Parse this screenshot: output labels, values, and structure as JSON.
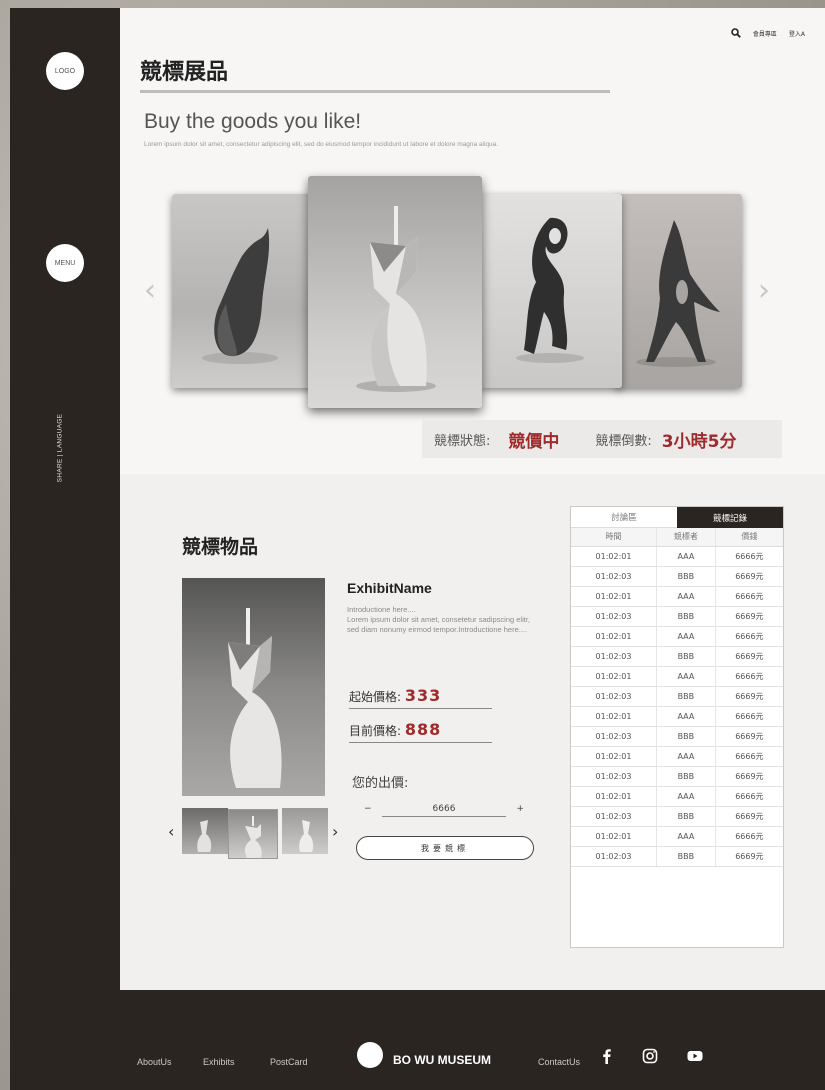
{
  "sidebar": {
    "logo_label": "LOGO",
    "menu_label": "MENU",
    "share_language": "SHARE | LANGUAGE"
  },
  "topbar": {
    "search_icon": "search-icon",
    "member_link": "會員專區",
    "login_link": "登入A"
  },
  "header": {
    "title": "競標展品",
    "hero_heading": "Buy the goods you like!",
    "hero_text": "Lorem ipsum dolor sit amet, consectetur adipiscing elit, sed do eiusmod tempor incididunt ut labore et dolore magna aliqua."
  },
  "carousel": {
    "prev_icon": "chevron-left-icon",
    "next_icon": "chevron-right-icon",
    "prev_glyph": "‹",
    "next_glyph": "›"
  },
  "status": {
    "state_label": "競標狀態:",
    "state_value": "競價中",
    "countdown_label": "競標倒數:",
    "countdown_value": "3小時5分"
  },
  "item": {
    "section_title": "競標物品",
    "name": "ExhibitName",
    "intro": "Introductione here....\nLorem ipsum dolor sit amet, consetetur sadipscing elitr, sed diam nonumy eirmod tempor.Introductione here....",
    "start_price_label": "起始價格:",
    "start_price": "333",
    "current_price_label": "目前價格:",
    "current_price": "888",
    "your_bid_label": "您的出價:",
    "bid_value": "6666",
    "minus": "−",
    "plus": "+",
    "bid_button": "我要競標",
    "thumb_prev": "‹",
    "thumb_next": "›"
  },
  "history": {
    "tabs": [
      "討論區",
      "競標記錄"
    ],
    "active_tab": 1,
    "columns": [
      "時間",
      "競標者",
      "價錢"
    ],
    "rows": [
      [
        "01:02:01",
        "AAA",
        "6666元"
      ],
      [
        "01:02:03",
        "BBB",
        "6669元"
      ],
      [
        "01:02:01",
        "AAA",
        "6666元"
      ],
      [
        "01:02:03",
        "BBB",
        "6669元"
      ],
      [
        "01:02:01",
        "AAA",
        "6666元"
      ],
      [
        "01:02:03",
        "BBB",
        "6669元"
      ],
      [
        "01:02:01",
        "AAA",
        "6666元"
      ],
      [
        "01:02:03",
        "BBB",
        "6669元"
      ],
      [
        "01:02:01",
        "AAA",
        "6666元"
      ],
      [
        "01:02:03",
        "BBB",
        "6669元"
      ],
      [
        "01:02:01",
        "AAA",
        "6666元"
      ],
      [
        "01:02:03",
        "BBB",
        "6669元"
      ],
      [
        "01:02:01",
        "AAA",
        "6666元"
      ],
      [
        "01:02:03",
        "BBB",
        "6669元"
      ],
      [
        "01:02:01",
        "AAA",
        "6666元"
      ],
      [
        "01:02:03",
        "BBB",
        "6669元"
      ]
    ]
  },
  "footer": {
    "links": [
      "AboutUs",
      "Exhibits",
      "PostCard"
    ],
    "brand": "BO WU MUSEUM",
    "contact": "ContactUs",
    "social_icons": [
      "facebook-icon",
      "instagram-icon",
      "youtube-icon"
    ]
  },
  "colors": {
    "dark": "#2b2522",
    "accent_red": "#9e2a2b",
    "panel": "#f7f6f4"
  }
}
